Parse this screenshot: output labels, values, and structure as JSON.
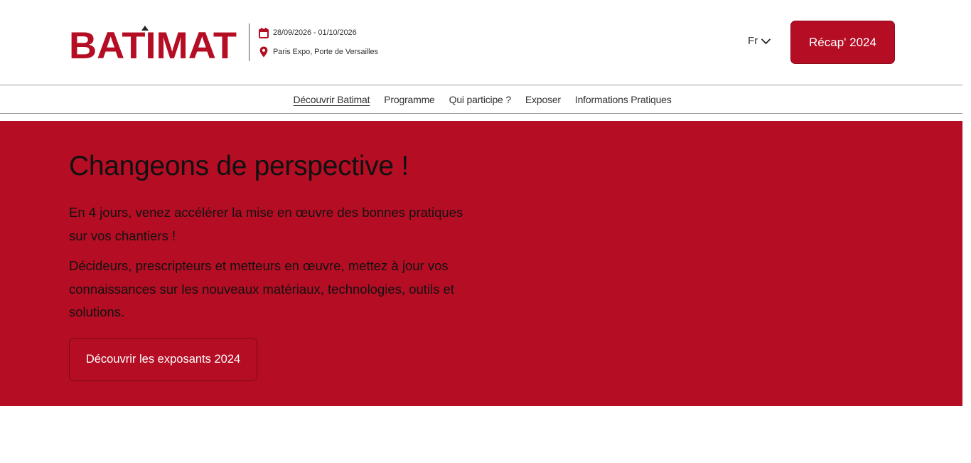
{
  "brand": {
    "logo_text": "BATIMAT",
    "accent_color": "#b50d24"
  },
  "event": {
    "dates": "28/09/2026 - 01/10/2026",
    "location": "Paris Expo, Porte de Versailles",
    "calendar_icon": "calendar-icon",
    "location_icon": "map-pin-icon"
  },
  "language": {
    "current": "Fr",
    "icon": "chevron-down-icon"
  },
  "recap_button": {
    "label": "Récap' 2024"
  },
  "nav": {
    "items": [
      {
        "label": "Découvrir Batimat",
        "active": true
      },
      {
        "label": "Programme",
        "active": false
      },
      {
        "label": "Qui participe ?",
        "active": false
      },
      {
        "label": "Exposer",
        "active": false
      },
      {
        "label": "Informations Pratiques",
        "active": false
      }
    ]
  },
  "hero": {
    "title": "Changeons de perspective !",
    "paragraph1": "En 4 jours, venez accélérer la mise en œuvre des bonnes pratiques sur vos chantiers !",
    "paragraph2": "Décideurs, prescripteurs et metteurs en œuvre, mettez  à jour vos connaissances sur les nouveaux matériaux, technologies, outils et solutions.",
    "cta_label": "Découvrir les exposants 2024",
    "background_color": "#b50d24"
  }
}
